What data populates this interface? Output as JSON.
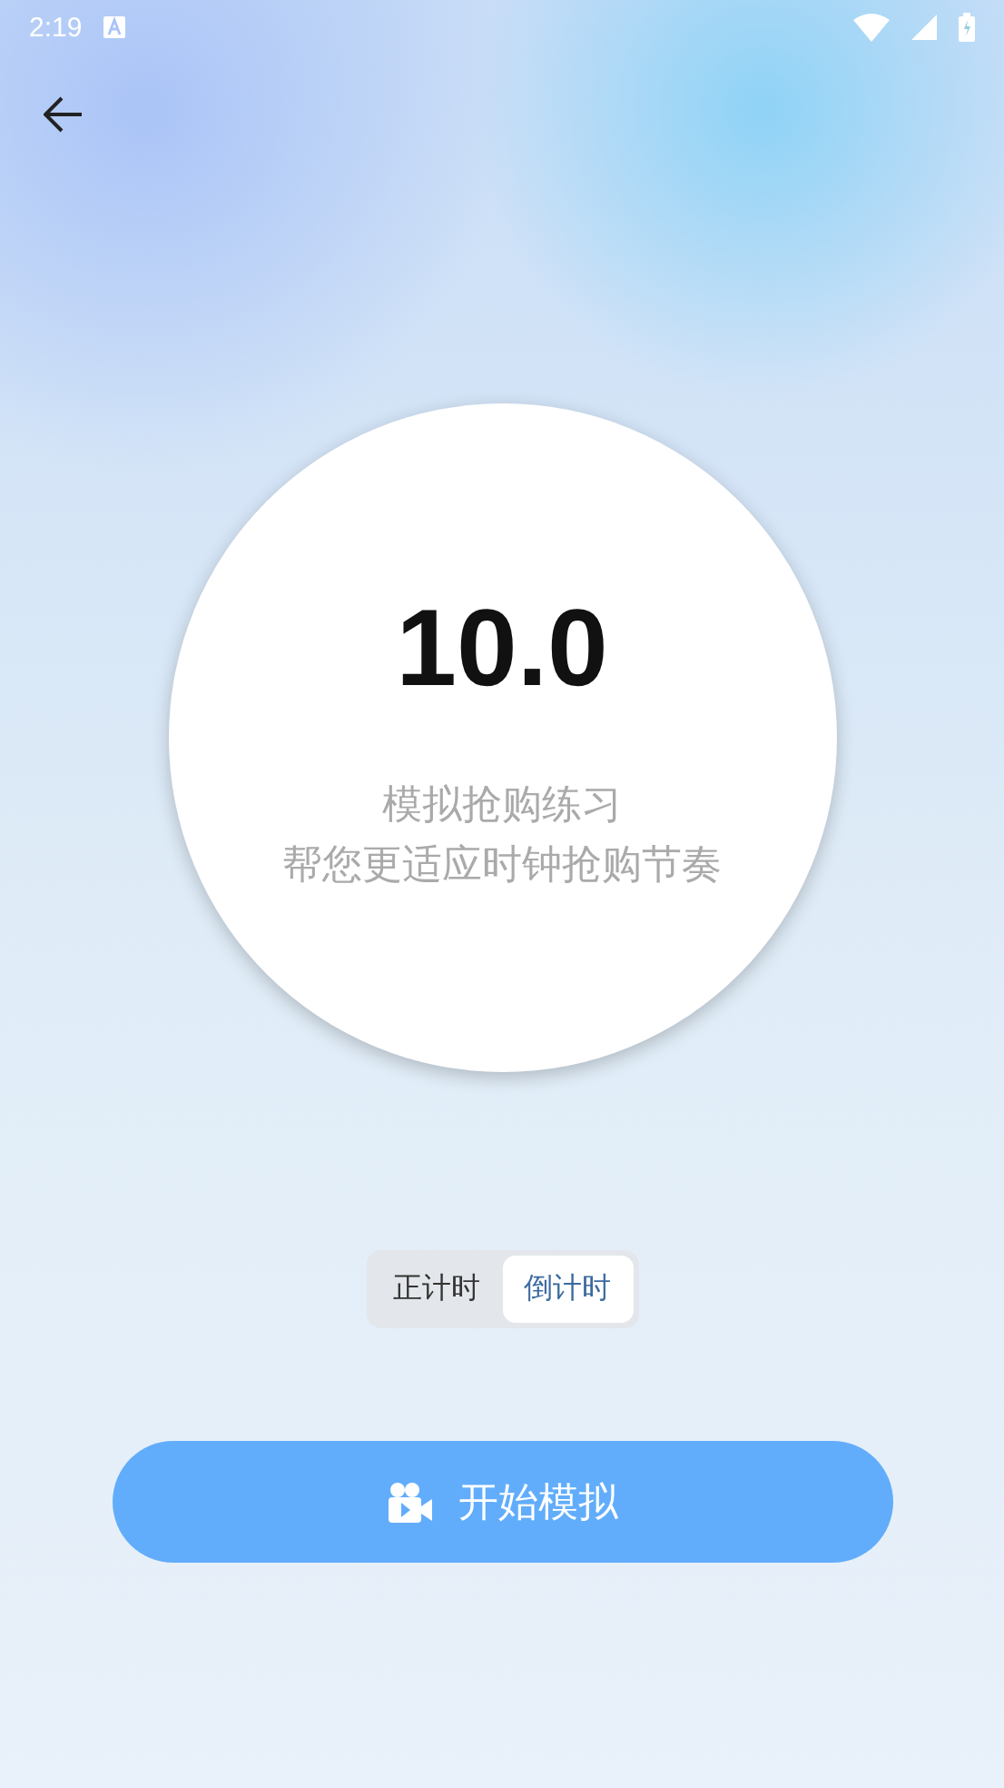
{
  "status_bar": {
    "time": "2:19"
  },
  "timer": {
    "value": "10.0",
    "lines": [
      "模拟抢购练习",
      "帮您更适应时钟抢购节奏"
    ]
  },
  "mode_toggle": [
    {
      "label": "正计时",
      "selected": false
    },
    {
      "label": "倒计时",
      "selected": true
    }
  ],
  "start_button": {
    "label": "开始模拟"
  }
}
